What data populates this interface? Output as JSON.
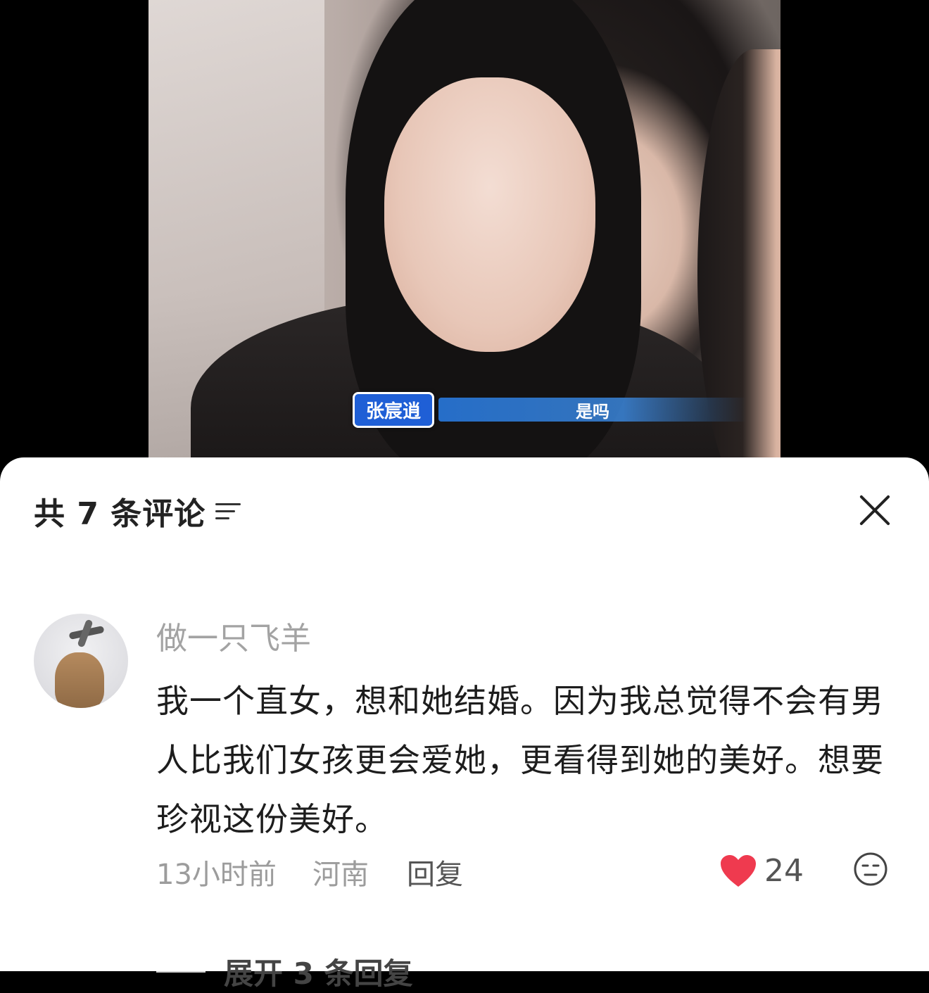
{
  "video": {
    "caption_name": "张宸逍",
    "caption_text": "是吗"
  },
  "sheet": {
    "comment_count_label": "共 7 条评论",
    "filter_icon": "filter-icon",
    "close_icon": "close-icon"
  },
  "comments": [
    {
      "username": "做一只飞羊",
      "text": "我一个直女，想和她结婚。因为我总觉得不会有男人比我们女孩更会爱她，更看得到她的美好。想要珍视这份美好。",
      "time": "13小时前",
      "location": "河南",
      "reply_label": "回复",
      "like_count": "24",
      "like_color": "#ef3a4f",
      "expand_label": "展开 3 条回复"
    }
  ]
}
